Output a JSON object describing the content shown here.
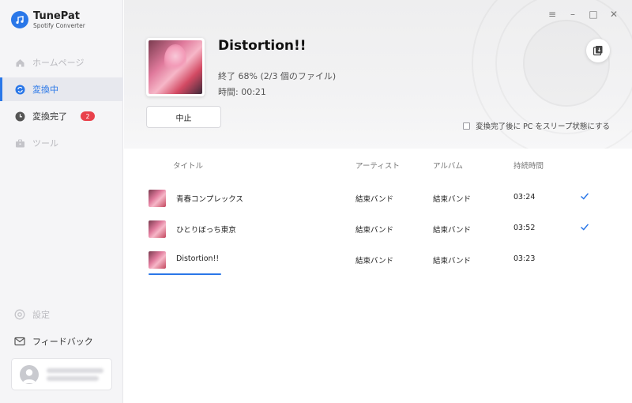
{
  "app": {
    "name": "TunePat",
    "subtitle": "Spotify Converter"
  },
  "sidebar": {
    "items": [
      {
        "label": "ホームページ",
        "icon": "home-icon"
      },
      {
        "label": "変換中",
        "icon": "converting-icon"
      },
      {
        "label": "変換完了",
        "icon": "clock-icon",
        "badge": "2"
      },
      {
        "label": "ツール",
        "icon": "toolbox-icon"
      }
    ],
    "settings_label": "設定",
    "feedback_label": "フィードバック"
  },
  "window_controls": {
    "menu": "≡",
    "minimize": "–",
    "maximize": "□",
    "close": "✕"
  },
  "now": {
    "title": "Distortion!!",
    "progress_text": "終了 68% (2/3 個のファイル)",
    "time_text": "時間: 00:21",
    "stop_label": "中止",
    "sleep_label": "変換完了後に PC をスリープ状態にする",
    "sleep_checked": false
  },
  "table": {
    "headers": [
      "タイトル",
      "アーティスト",
      "アルバム",
      "持続時間"
    ],
    "rows": [
      {
        "title": "青春コンプレックス",
        "artist": "結束バンド",
        "album": "結束バンド",
        "duration": "03:24",
        "done": true
      },
      {
        "title": "ひとりぼっち東京",
        "artist": "結束バンド",
        "album": "結束バンド",
        "duration": "03:52",
        "done": true
      },
      {
        "title": "Distortion!!",
        "artist": "結束バンド",
        "album": "結束バンド",
        "duration": "03:23",
        "done": false,
        "progress": 0.68
      }
    ]
  },
  "colors": {
    "accent": "#2a77e8",
    "badge": "#e9414b"
  }
}
